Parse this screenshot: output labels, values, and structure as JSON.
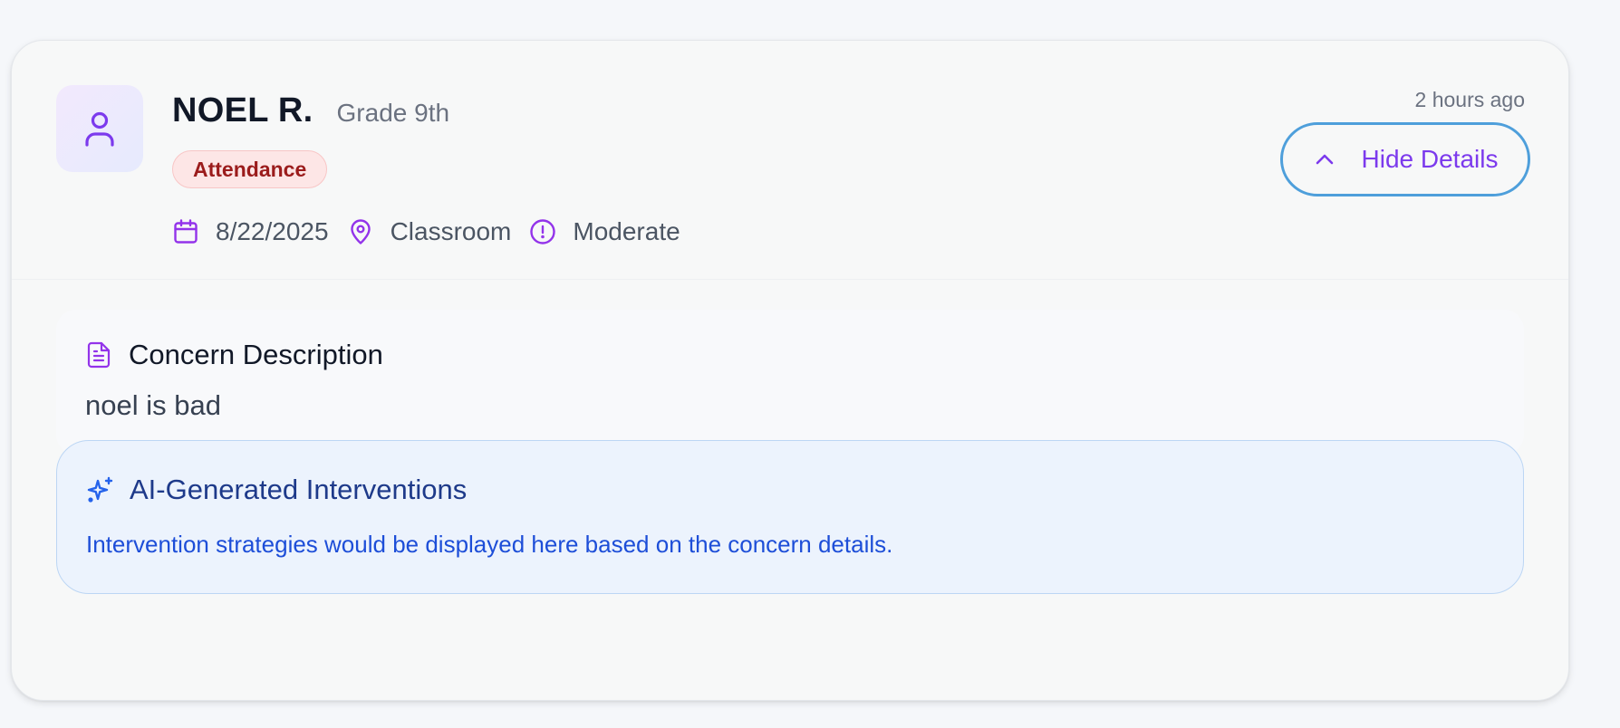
{
  "student": {
    "name": "NOEL R.",
    "grade": "Grade 9th",
    "avatar_icon": "user-icon"
  },
  "concern": {
    "category": "Attendance",
    "date": "8/22/2025",
    "location": "Classroom",
    "severity": "Moderate",
    "timestamp": "2 hours ago"
  },
  "toggle": {
    "label": "Hide Details",
    "icon": "chevron-up-icon"
  },
  "description_panel": {
    "title": "Concern Description",
    "text": "noel is bad",
    "icon": "document-icon"
  },
  "ai_panel": {
    "title": "AI-Generated Interventions",
    "text": "Intervention strategies would be displayed here based on the concern details.",
    "icon": "sparkles-icon"
  },
  "colors": {
    "accent_purple": "#7c3aed",
    "badge_bg": "#fde6e6",
    "badge_text": "#9b1c1c",
    "focus_ring": "#4e9fdb",
    "ai_bg": "#ecf3fd",
    "ai_title": "#1e3a8a",
    "ai_text": "#1d4ed8"
  }
}
